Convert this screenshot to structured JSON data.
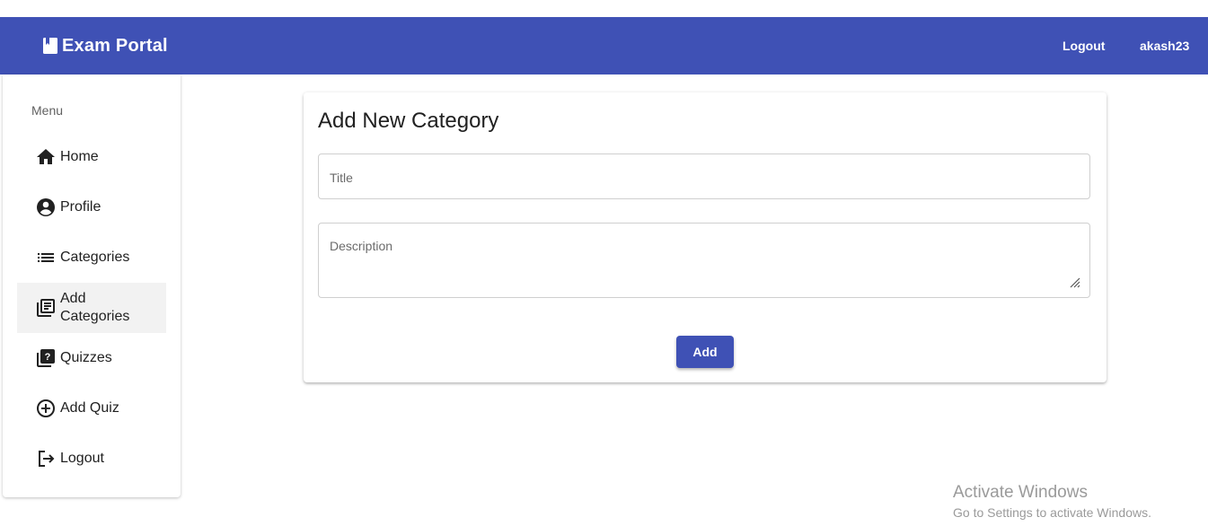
{
  "navbar": {
    "brand_icon": "book-icon",
    "title": "Exam Portal",
    "logout_label": "Logout",
    "username": "akash23",
    "color": "#3f51b5"
  },
  "sidebar": {
    "menu_title": "Menu",
    "items": [
      {
        "label": "Home",
        "icon": "home-icon"
      },
      {
        "label": "Profile",
        "icon": "account-circle-icon"
      },
      {
        "label": "Categories",
        "icon": "list-icon"
      },
      {
        "label": "Add Categories",
        "icon": "library-books-icon",
        "active": true
      },
      {
        "label": "Quizzes",
        "icon": "quiz-icon"
      },
      {
        "label": "Add Quiz",
        "icon": "add-circle-icon"
      },
      {
        "label": "Logout",
        "icon": "logout-icon"
      }
    ]
  },
  "form": {
    "heading": "Add New Category",
    "title_placeholder": "Title",
    "title_value": "",
    "description_placeholder": "Description",
    "description_value": "",
    "submit_label": "Add"
  },
  "watermark": {
    "title": "Activate Windows",
    "subtitle": "Go to Settings to activate Windows."
  }
}
